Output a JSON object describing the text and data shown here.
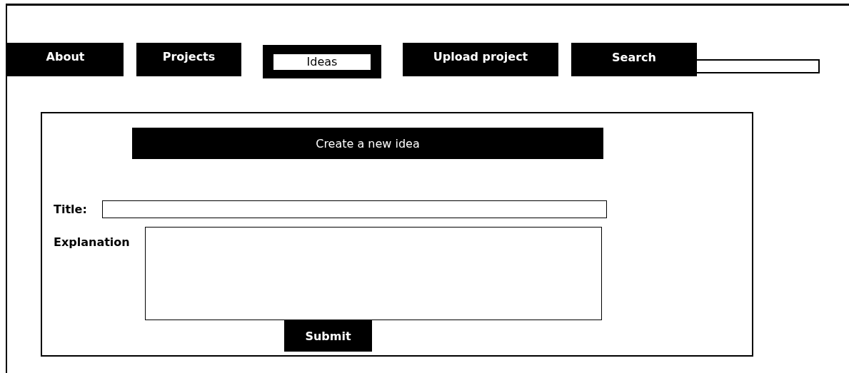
{
  "nav": {
    "tabs": [
      {
        "label": "About",
        "selected": false
      },
      {
        "label": "Projects",
        "selected": false
      },
      {
        "label": "Ideas",
        "selected": true
      },
      {
        "label": "Upload project",
        "selected": false
      }
    ],
    "search": {
      "button": "Search"
    }
  },
  "form": {
    "heading": "Create a new idea",
    "title_label": "Title:",
    "explanation_label": "Explanation",
    "submit": "Submit"
  }
}
